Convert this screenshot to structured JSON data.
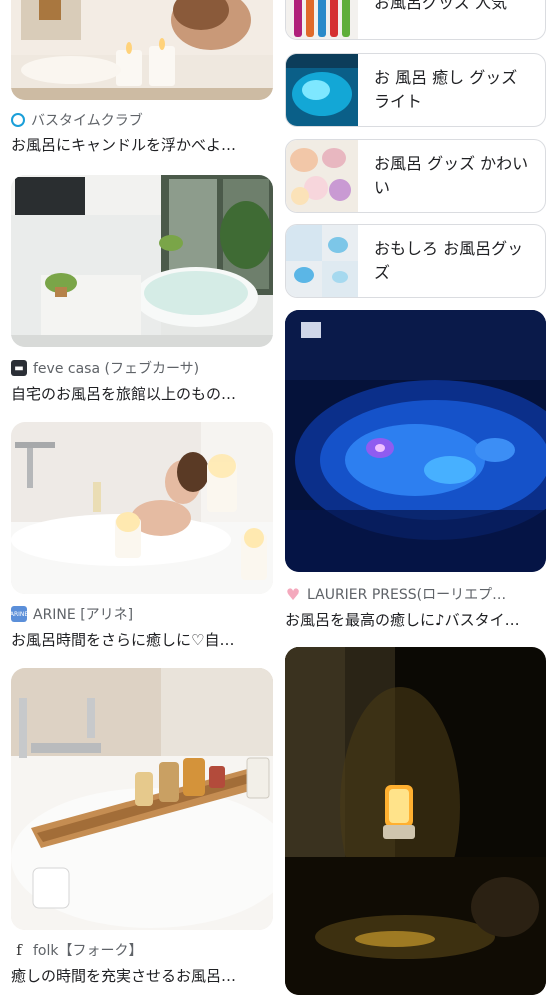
{
  "left_results": [
    {
      "source": "バスタイムクラブ",
      "title": "お風呂にキャンドルを浮かべよ…",
      "source_icon": "circle-o-icon",
      "icon_color": "#1a9fd9"
    },
    {
      "source": "feve casa (フェブカーサ)",
      "title": "自宅のお風呂を旅館以上のもの…",
      "source_icon": "feve-logo-icon",
      "icon_color": "#2b2f36"
    },
    {
      "source": "ARINE [アリネ]",
      "title": "お風呂時間をさらに癒しに♡自…",
      "source_icon": "arine-logo-icon",
      "icon_color": "#5b8fd9"
    },
    {
      "source": "folk【フォーク】",
      "title": "癒しの時間を充実させるお風呂…",
      "source_icon": "folk-f-icon",
      "icon_color": "#333333"
    }
  ],
  "related_chips": [
    {
      "label": "お風呂グッズ 人気"
    },
    {
      "label": "お 風呂 癒し グッズ ライト"
    },
    {
      "label": "お風呂 グッズ かわいい"
    },
    {
      "label": "おもしろ お風呂グッズ"
    }
  ],
  "right_results": [
    {
      "source": "LAURIER PRESS(ローリエプ…",
      "title": "お風呂を最高の癒しに♪バスタイ…",
      "source_icon": "heart-icon",
      "icon_color": "#f4a9bd"
    },
    {
      "source": "",
      "title": ""
    }
  ]
}
